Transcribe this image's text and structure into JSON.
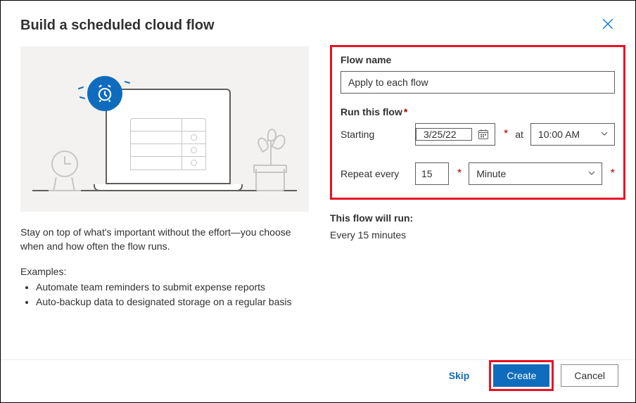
{
  "dialog": {
    "title": "Build a scheduled cloud flow",
    "close_label": "Close"
  },
  "illustration": {
    "clock_icon": "alarm-clock-icon"
  },
  "info": {
    "description": "Stay on top of what's important without the effort—you choose when and how often the flow runs.",
    "examples_label": "Examples:",
    "examples": [
      "Automate team reminders to submit expense reports",
      "Auto-backup data to designated storage on a regular basis"
    ]
  },
  "form": {
    "flow_name_label": "Flow name",
    "flow_name_value": "Apply to each flow",
    "run_label": "Run this flow",
    "starting_label": "Starting",
    "starting_date": "3/25/22",
    "at_label": "at",
    "starting_time": "10:00 AM",
    "repeat_label": "Repeat every",
    "repeat_value": "15",
    "repeat_unit": "Minute"
  },
  "summary": {
    "label": "This flow will run:",
    "text": "Every 15 minutes"
  },
  "footer": {
    "skip": "Skip",
    "create": "Create",
    "cancel": "Cancel"
  }
}
